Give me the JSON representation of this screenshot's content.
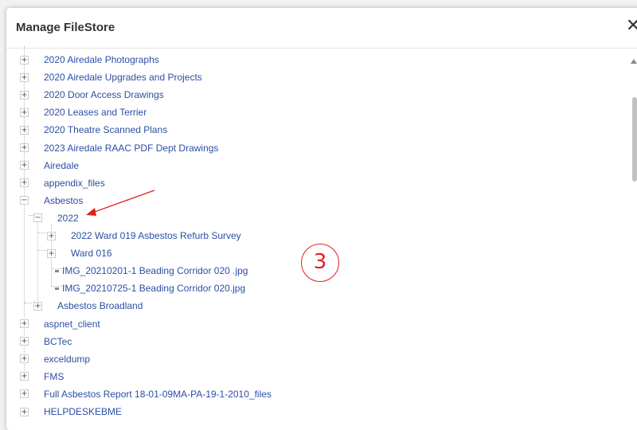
{
  "dialog": {
    "title": "Manage FileStore",
    "close_symbol": "✕"
  },
  "tree": [
    {
      "label": "2020 Airedale Photographs",
      "toggle": "+",
      "level": 0
    },
    {
      "label": "2020 Airedale Upgrades and Projects",
      "toggle": "+",
      "level": 0
    },
    {
      "label": "2020 Door Access Drawings",
      "toggle": "+",
      "level": 0
    },
    {
      "label": "2020 Leases and Terrier",
      "toggle": "+",
      "level": 0
    },
    {
      "label": "2020 Theatre Scanned Plans",
      "toggle": "+",
      "level": 0
    },
    {
      "label": "2023 Airedale RAAC PDF Dept Drawings",
      "toggle": "+",
      "level": 0
    },
    {
      "label": "Airedale",
      "toggle": "+",
      "level": 0
    },
    {
      "label": "appendix_files",
      "toggle": "+",
      "level": 0
    },
    {
      "label": "Asbestos",
      "toggle": "−",
      "level": 0
    },
    {
      "label": "2022",
      "toggle": "−",
      "level": 1
    },
    {
      "label": "2022 Ward 019 Asbestos Refurb Survey",
      "toggle": "+",
      "level": 2
    },
    {
      "label": "Ward 016",
      "toggle": "+",
      "level": 2
    },
    {
      "label": "IMG_20210201-1 Beading Corridor 020 .jpg",
      "type": "file",
      "level": 2
    },
    {
      "label": "IMG_20210725-1 Beading Corridor 020.jpg",
      "type": "file",
      "level": 2
    },
    {
      "label": "Asbestos Broadland",
      "toggle": "+",
      "level": 1
    },
    {
      "label": "aspnet_client",
      "toggle": "+",
      "level": 0
    },
    {
      "label": "BCTec",
      "toggle": "+",
      "level": 0
    },
    {
      "label": "exceldump",
      "toggle": "+",
      "level": 0
    },
    {
      "label": "FMS",
      "toggle": "+",
      "level": 0
    },
    {
      "label": "Full Asbestos Report 18-01-09MA-PA-19-1-2010_files",
      "toggle": "+",
      "level": 0
    },
    {
      "label": "HELPDESKEBME",
      "toggle": "+",
      "level": 0
    }
  ],
  "annotation": {
    "number": "3",
    "color": "#e02020"
  },
  "colors": {
    "link": "#2c4fa4",
    "title": "#333333"
  }
}
